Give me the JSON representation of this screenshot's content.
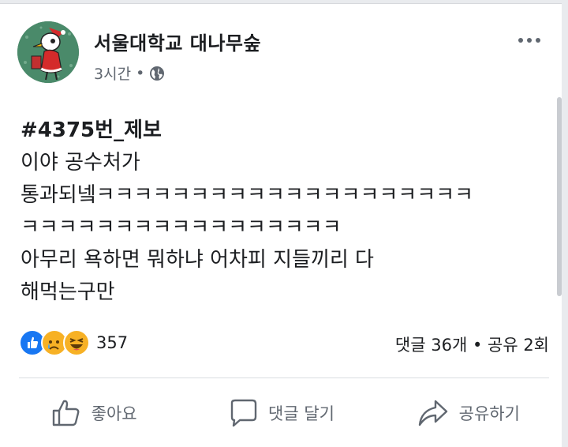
{
  "post": {
    "page_name": "서울대학교 대나무숲",
    "time": "3시간",
    "separator": "•",
    "privacy_icon": "globe-icon",
    "hashtag": "#4375번_제보",
    "lines": [
      "이야 공수처가",
      "통과되넼ㅋㅋㅋㅋㅋㅋㅋㅋㅋㅋㅋㅋㅋㅋㅋㅋㅋㅋㅋㅋ",
      "ㅋㅋㅋㅋㅋㅋㅋㅋㅋㅋㅋㅋㅋㅋㅋㅋㅋ",
      "아무리 욕하면 뭐하냐 어차피 지들끼리 다",
      "해먹는구만"
    ]
  },
  "stats": {
    "reaction_count": "357",
    "comments_shares": "댓글 36개 • 공유 2회",
    "reactions": [
      "like-icon",
      "sad-icon",
      "haha-icon"
    ]
  },
  "actions": {
    "like": "좋아요",
    "comment": "댓글 달기",
    "share": "공유하기"
  },
  "colors": {
    "like_blue": "#1877f2",
    "emoji_yellow": "#f7b125",
    "secondary_text": "#606770"
  }
}
